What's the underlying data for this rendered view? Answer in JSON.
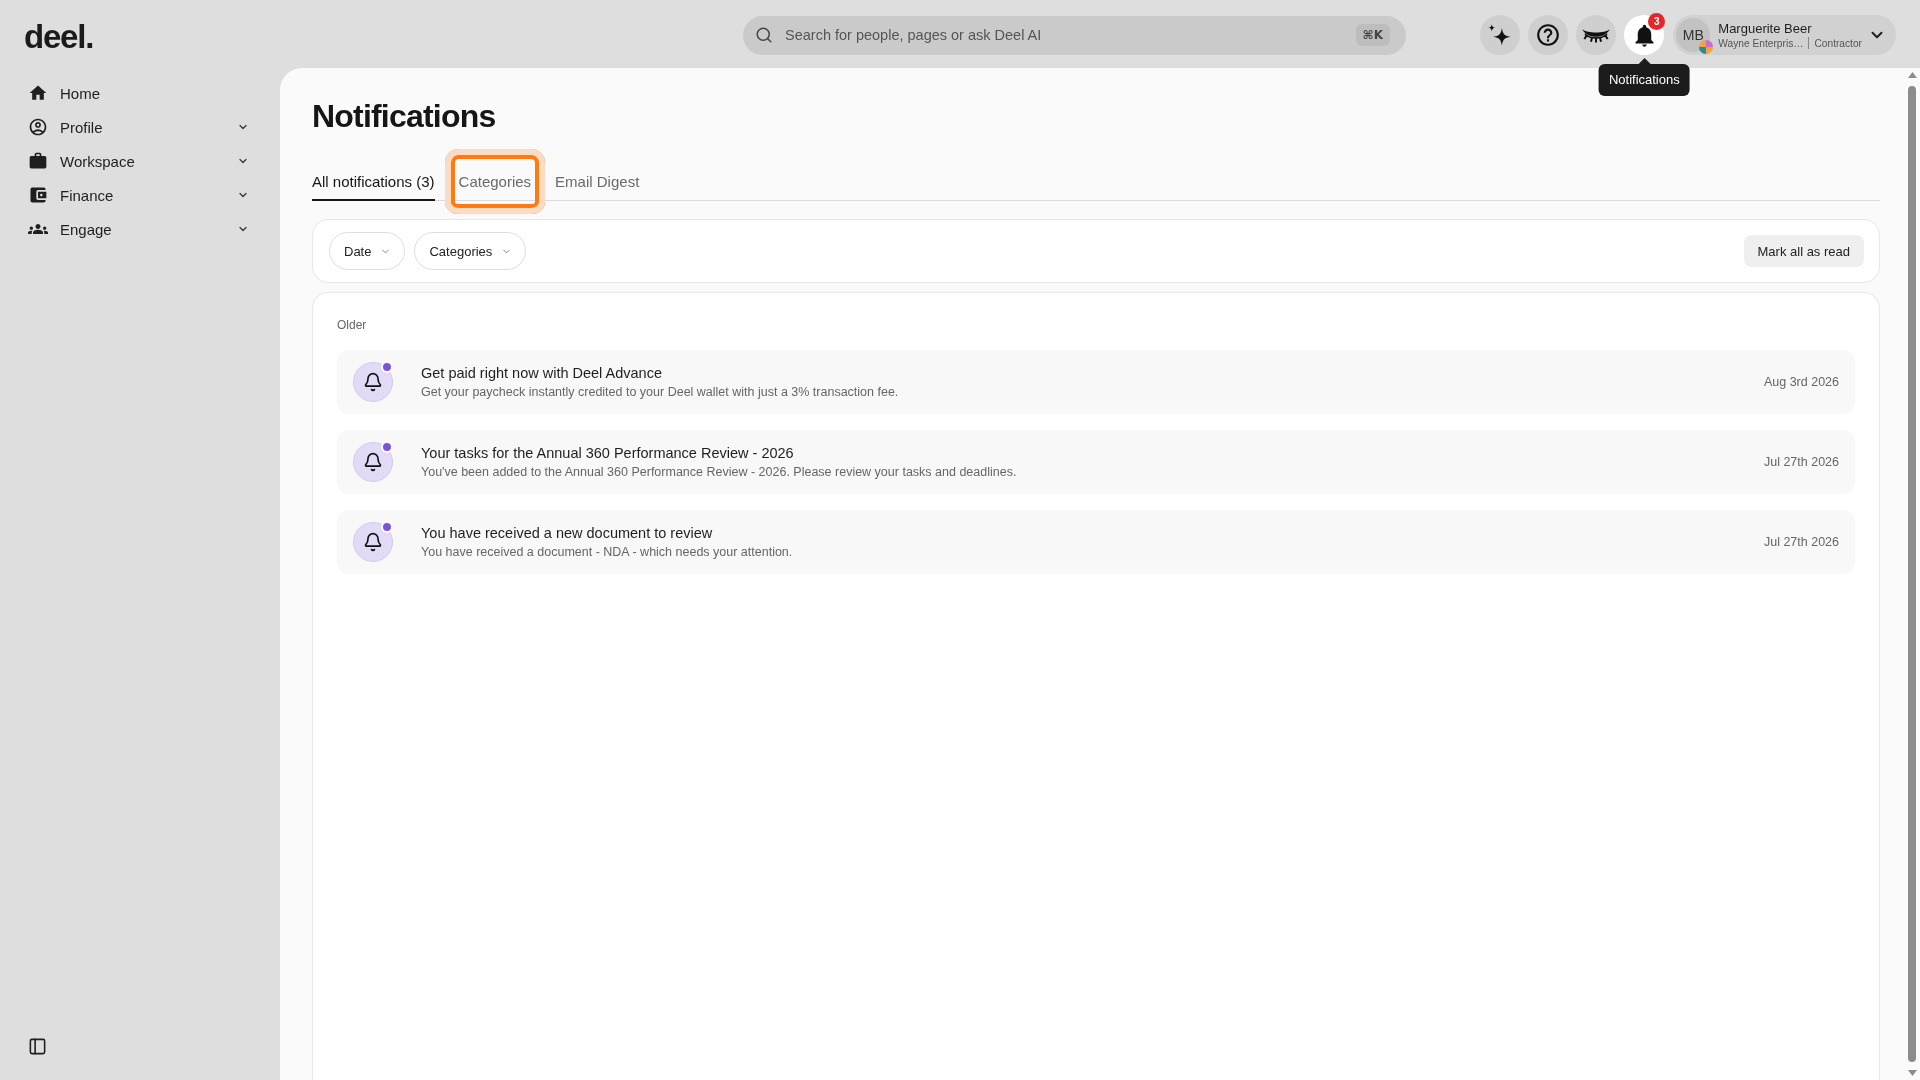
{
  "logo": {
    "text": "deel."
  },
  "sidebar": {
    "items": [
      {
        "label": "Home",
        "expandable": false
      },
      {
        "label": "Profile",
        "expandable": true
      },
      {
        "label": "Workspace",
        "expandable": true
      },
      {
        "label": "Finance",
        "expandable": true
      },
      {
        "label": "Engage",
        "expandable": true
      }
    ]
  },
  "search": {
    "placeholder": "Search for people, pages or ask Deel AI",
    "shortcut": "⌘K"
  },
  "top_actions": [
    {
      "active": false
    },
    {
      "active": false
    },
    {
      "active": false
    },
    {
      "active": true,
      "badge": "3",
      "tooltip": "Notifications"
    }
  ],
  "user": {
    "initials": "MB",
    "name": "Marguerite Beer",
    "company": "Wayne Enterpris…",
    "role": "Contractor"
  },
  "page": {
    "title": "Notifications",
    "tabs": [
      {
        "label": "All notifications (3)",
        "selected": true,
        "focused": false
      },
      {
        "label": "Categories",
        "selected": false,
        "focused": true
      },
      {
        "label": "Email Digest",
        "selected": false,
        "focused": false
      }
    ]
  },
  "filters": {
    "dropdowns": [
      {
        "label": "Date"
      },
      {
        "label": "Categories"
      }
    ],
    "mark_all_button": "Mark all as read"
  },
  "list": {
    "section_label": "Older",
    "notifications": [
      {
        "title": "Get paid right now with Deel Advance",
        "body": "Get your paycheck instantly credited to your Deel wallet with just a 3% transaction fee.",
        "date": "Aug 3rd 2026",
        "unread": true
      },
      {
        "title": "Your tasks for the Annual 360 Performance Review - 2026",
        "body": "You've been added to the Annual 360 Performance Review - 2026. Please review your tasks and deadlines.",
        "date": "Jul 27th 2026",
        "unread": true
      },
      {
        "title": "You have received a new document to review",
        "body": "You have received a document - NDA - which needs your attention.",
        "date": "Jul 27th 2026",
        "unread": true
      }
    ]
  }
}
